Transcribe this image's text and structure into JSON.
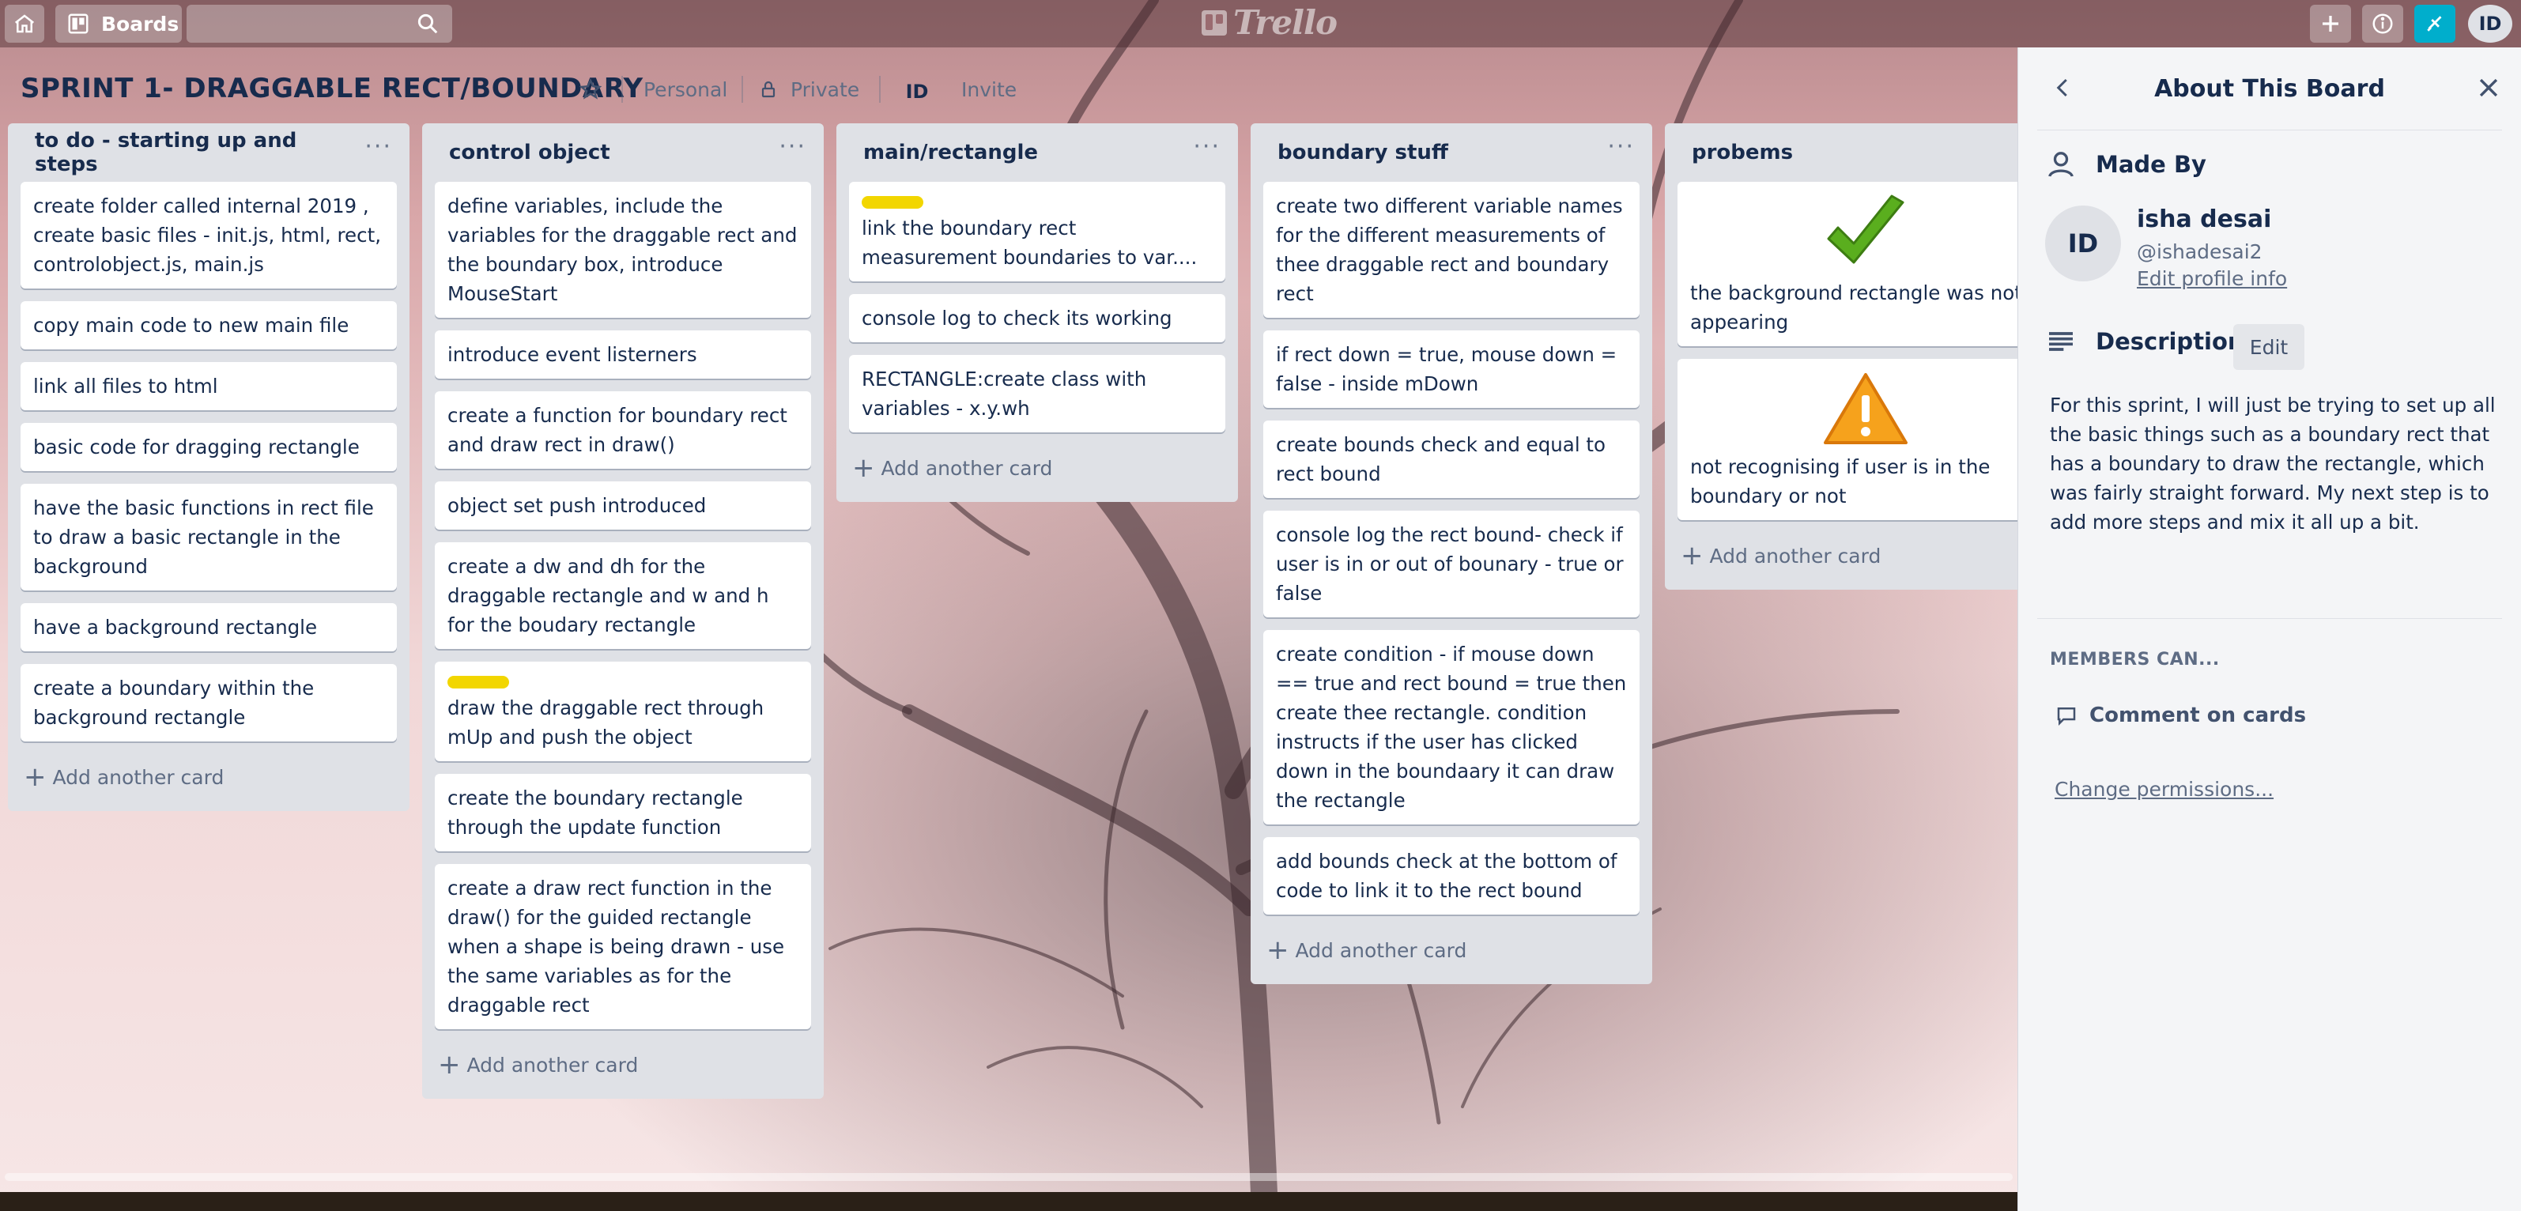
{
  "header": {
    "boards_label": "Boards",
    "search_placeholder": "",
    "logo_text": "Trello",
    "user_initials": "ID"
  },
  "board": {
    "title": "SPRINT 1- DRAGGABLE RECT/BOUNDARY",
    "visibility_team": "Personal",
    "visibility_privacy": "Private",
    "member_initials": "ID",
    "invite_label": "Invite"
  },
  "lists": [
    {
      "title": "to do - starting up and steps",
      "cards": [
        {
          "text": "create folder called internal 2019 , create basic files - init.js, html, rect, controlobject.js, main.js"
        },
        {
          "text": "copy main code to new main file"
        },
        {
          "text": "link all files to html"
        },
        {
          "text": "basic code for dragging rectangle"
        },
        {
          "text": "have the basic functions in rect file to draw a basic rectangle in the background"
        },
        {
          "text": "have a background rectangle"
        },
        {
          "text": "create a boundary within the background rectangle"
        }
      ],
      "add_label": "Add another card"
    },
    {
      "title": "control object",
      "cards": [
        {
          "text": "define variables, include the variables for the draggable rect and the boundary box, introduce MouseStart"
        },
        {
          "text": "introduce event listerners"
        },
        {
          "text": "create a function for boundary rect and draw rect in draw()"
        },
        {
          "text": "object set push introduced"
        },
        {
          "text": "create a dw and dh for the draggable rectangle and w and h for the boudary rectangle"
        },
        {
          "text": "draw the draggable rect through mUp and push the object",
          "label": "yellow"
        },
        {
          "text": "create the boundary rectangle through the update function"
        },
        {
          "text": "create a draw rect function in the draw() for the guided rectangle when a shape is being drawn - use the same variables as for the draggable rect"
        }
      ],
      "add_label": "Add another card"
    },
    {
      "title": "main/rectangle",
      "cards": [
        {
          "text": "link the boundary rect measurement boundaries to var....",
          "label": "yellow"
        },
        {
          "text": "console log to check its working"
        },
        {
          "text": "RECTANGLE:create class with variables - x.y.wh"
        }
      ],
      "add_label": "Add another card"
    },
    {
      "title": "boundary stuff",
      "cards": [
        {
          "text": "create two different variable names for the different measurements of thee draggable rect and boundary rect"
        },
        {
          "text": "if rect down = true, mouse down = false - inside mDown"
        },
        {
          "text": "create bounds check and equal to rect bound"
        },
        {
          "text": "console log the rect bound- check if user is in or out of bounary - true or false"
        },
        {
          "text": "create condition - if mouse down == true and rect bound = true then create thee rectangle. condition instructs if the user has clicked down in the boundaary it can draw the rectangle"
        },
        {
          "text": "add bounds check at the bottom of code to link it to the rect bound"
        }
      ],
      "add_label": "Add another card"
    },
    {
      "title": "probems",
      "cards": [
        {
          "text": "the background rectangle was not appearing",
          "image": "checkmark-icon"
        },
        {
          "text": "not recognising if user is in the boundary or not",
          "image": "warning-icon"
        }
      ],
      "add_label": "Add another card"
    }
  ],
  "sidebar": {
    "title": "About This Board",
    "made_by_heading": "Made By",
    "profile_initials": "ID",
    "profile_name": "isha desai",
    "profile_handle": "@ishadesai2",
    "edit_profile": "Edit profile info",
    "description_heading": "Description",
    "edit_label": "Edit",
    "description": "For this sprint, I will just be trying to set up all the basic things such as a boundary rect that has a boundary to draw the rectangle, which was fairly straight forward. My next step is to add more steps and mix it all up a bit.",
    "members_can": "MEMBERS CAN...",
    "comment_on_cards": "Comment on cards",
    "change_permissions": "Change permissions..."
  },
  "colors": {
    "label_yellow": "#f2d600",
    "notification_button": "#00aecc",
    "list_background": "#dfe1e6"
  }
}
